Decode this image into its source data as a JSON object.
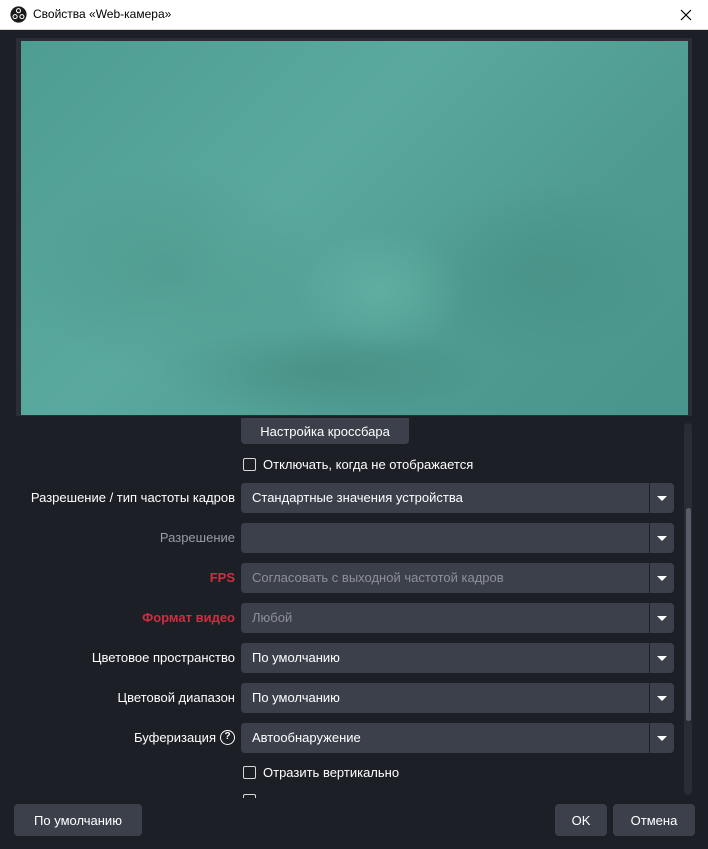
{
  "window": {
    "title": "Свойства «Web-камера»",
    "icon": "obs-logo-icon",
    "close_icon": "close-icon"
  },
  "preview": {
    "description_color": "#56a398"
  },
  "properties": {
    "crossbar_button": "Настройка кроссбара",
    "deactivate_checkbox": {
      "label": "Отключать, когда не отображается",
      "checked": false
    },
    "rows": [
      {
        "label": "Разрешение / тип частоты кадров",
        "value": "Стандартные значения устройства",
        "state": "normal"
      },
      {
        "label": "Разрешение",
        "value": "",
        "state": "dim"
      },
      {
        "label": "FPS",
        "value": "Согласовать с выходной частотой кадров",
        "state": "warn"
      },
      {
        "label": "Формат видео",
        "value": "Любой",
        "state": "warn"
      },
      {
        "label": "Цветовое пространство",
        "value": "По умолчанию",
        "state": "normal"
      },
      {
        "label": "Цветовой диапазон",
        "value": "По умолчанию",
        "state": "normal"
      },
      {
        "label": "Буферизация",
        "value": "Автообнаружение",
        "state": "normal",
        "help_icon": "help-icon"
      }
    ],
    "flip_checkbox": {
      "label": "Отразить вертикально",
      "checked": false
    }
  },
  "footer": {
    "defaults_button": "По умолчанию",
    "ok_button": "OK",
    "cancel_button": "Отмена"
  },
  "colors": {
    "background": "#1d1f26",
    "control": "#3c404b",
    "warning": "#d12d40"
  }
}
